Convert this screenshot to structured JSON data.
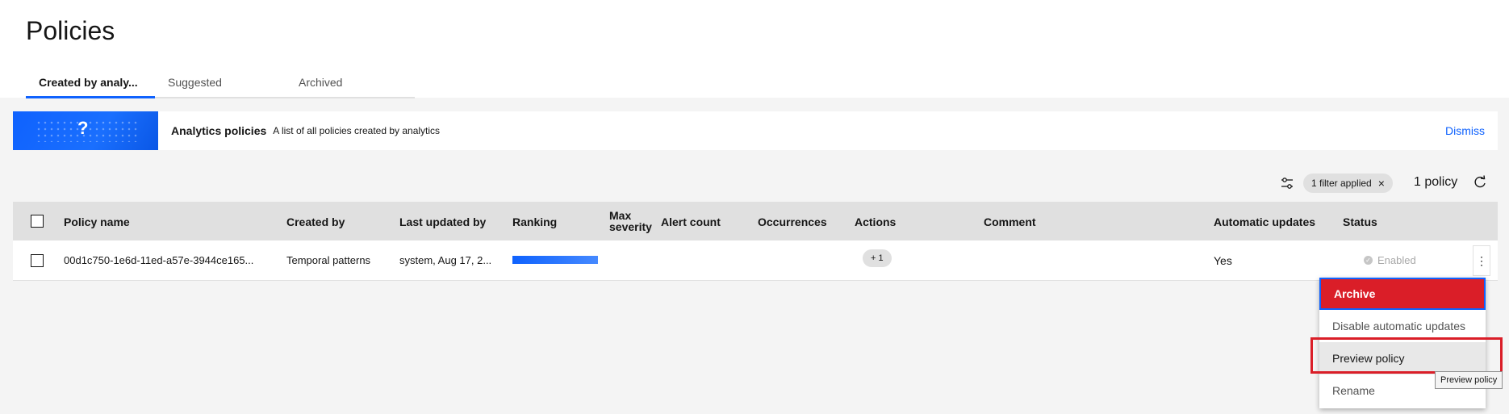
{
  "page": {
    "title": "Policies"
  },
  "tabs": [
    {
      "label": "Created by analy..."
    },
    {
      "label": "Suggested"
    },
    {
      "label": "Archived"
    }
  ],
  "banner": {
    "title": "Analytics policies",
    "description": "A list of all policies created by analytics",
    "dismiss_label": "Dismiss"
  },
  "toolbar": {
    "filter_tag": "1 filter applied",
    "filter_tag_close": "×",
    "policy_count": "1 policy"
  },
  "table": {
    "headers": {
      "policy_name": "Policy name",
      "created_by": "Created by",
      "last_updated_by": "Last updated by",
      "ranking": "Ranking",
      "max_severity_1": "Max",
      "max_severity_2": "severity",
      "alert_count": "Alert count",
      "occurrences": "Occurrences",
      "actions": "Actions",
      "comment": "Comment",
      "automatic_updates": "Automatic updates",
      "status": "Status"
    },
    "rows": [
      {
        "policy_name": "00d1c750-1e6d-11ed-a57e-3944ce165...",
        "created_by": "Temporal patterns",
        "last_updated_by": "system, Aug 17, 2...",
        "actions_chip": "+ 1",
        "automatic_updates": "Yes",
        "status": "Enabled",
        "overflow": "⋮"
      }
    ]
  },
  "menu": {
    "items": [
      {
        "label": "Archive"
      },
      {
        "label": "Disable automatic updates"
      },
      {
        "label": "Preview policy"
      },
      {
        "label": "Rename"
      }
    ]
  },
  "tooltip": {
    "text": "Preview policy"
  },
  "colors": {
    "accent": "#0f62fe",
    "danger": "#da1e28"
  }
}
